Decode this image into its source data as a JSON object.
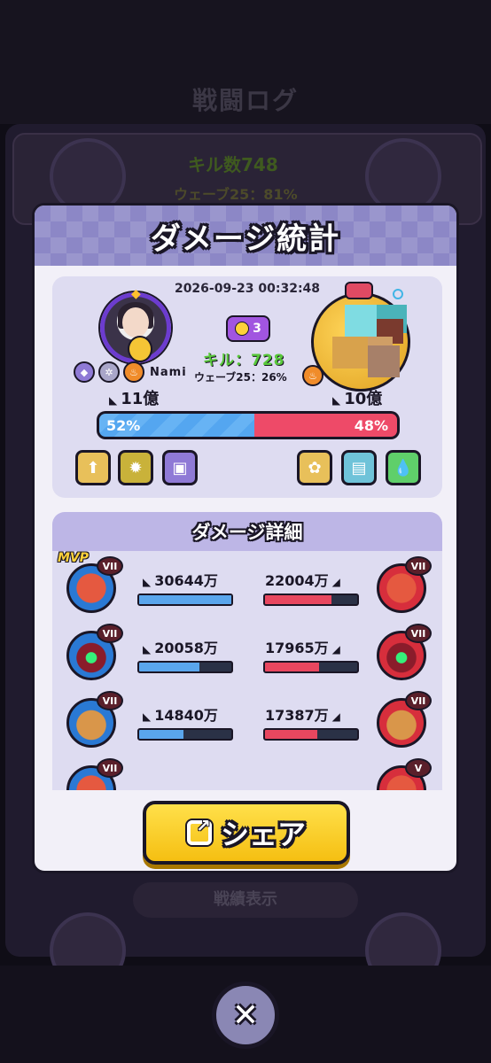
{
  "background": {
    "title": "戦闘ログ",
    "kill_line": "キル数748",
    "wave_line": "ウェーブ25：81%",
    "pill": "戦績表示"
  },
  "modal": {
    "title": "ダメージ統計",
    "datetime": "2026-09-23 00:32:48",
    "player_left": {
      "name": "Nami",
      "power": "11億"
    },
    "player_right": {
      "power": "10億"
    },
    "team_level": "3",
    "kill": "キル：728",
    "wave": "ウェーブ25：26%",
    "share_left": "52%",
    "share_right": "48%",
    "share_left_value": 0.52,
    "detail_title": "ダメージ詳細",
    "mvp": "MVP",
    "rows": [
      {
        "left_rank": "VII",
        "right_rank": "VII",
        "left_dmg": "30644万",
        "right_dmg": "22004万",
        "left_fill": 1.0,
        "right_fill": 0.72
      },
      {
        "left_rank": "VII",
        "right_rank": "VII",
        "left_dmg": "20058万",
        "right_dmg": "17965万",
        "left_fill": 0.65,
        "right_fill": 0.59
      },
      {
        "left_rank": "VII",
        "right_rank": "VII",
        "left_dmg": "14840万",
        "right_dmg": "17387万",
        "left_fill": 0.48,
        "right_fill": 0.57
      },
      {
        "left_rank": "VII",
        "right_rank": "V"
      }
    ],
    "share_button": "シェア"
  },
  "colors": {
    "accent_blue": "#5aa6ec",
    "accent_red": "#e8475f",
    "kill_green": "#58c83a",
    "button_yellow": "#f5bf12"
  }
}
